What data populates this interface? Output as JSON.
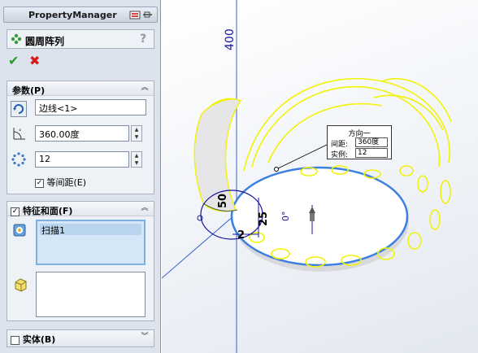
{
  "panel": {
    "title": "PropertyManager",
    "feature_title": "圆周阵列",
    "help": "?",
    "ok_symbol": "✔",
    "cancel_symbol": "✖"
  },
  "params": {
    "title": "参数(P)",
    "edge_value": "边线<1>",
    "angle_value": "360.00度",
    "count_value": "12",
    "equal_spacing_label": "等间距(E)",
    "equal_spacing_checked": true
  },
  "features": {
    "title": "特征和面(F)",
    "checked": true,
    "items": [
      "扫描1"
    ]
  },
  "bodies": {
    "title": "实体(B)",
    "checked": false
  },
  "viewport": {
    "dim_400": "400",
    "dim_50": "50",
    "dim_25": "25",
    "dim_2": "2",
    "dim_0": "0°",
    "callout": {
      "title": "方向一",
      "spacing_label": "间距:",
      "spacing_value": "360度",
      "count_label": "实例:",
      "count_value": "12"
    }
  },
  "colors": {
    "preview_yellow": "#f2f20a",
    "edge_blue": "#3b7fe0",
    "dimension_blue": "#1515a0"
  }
}
